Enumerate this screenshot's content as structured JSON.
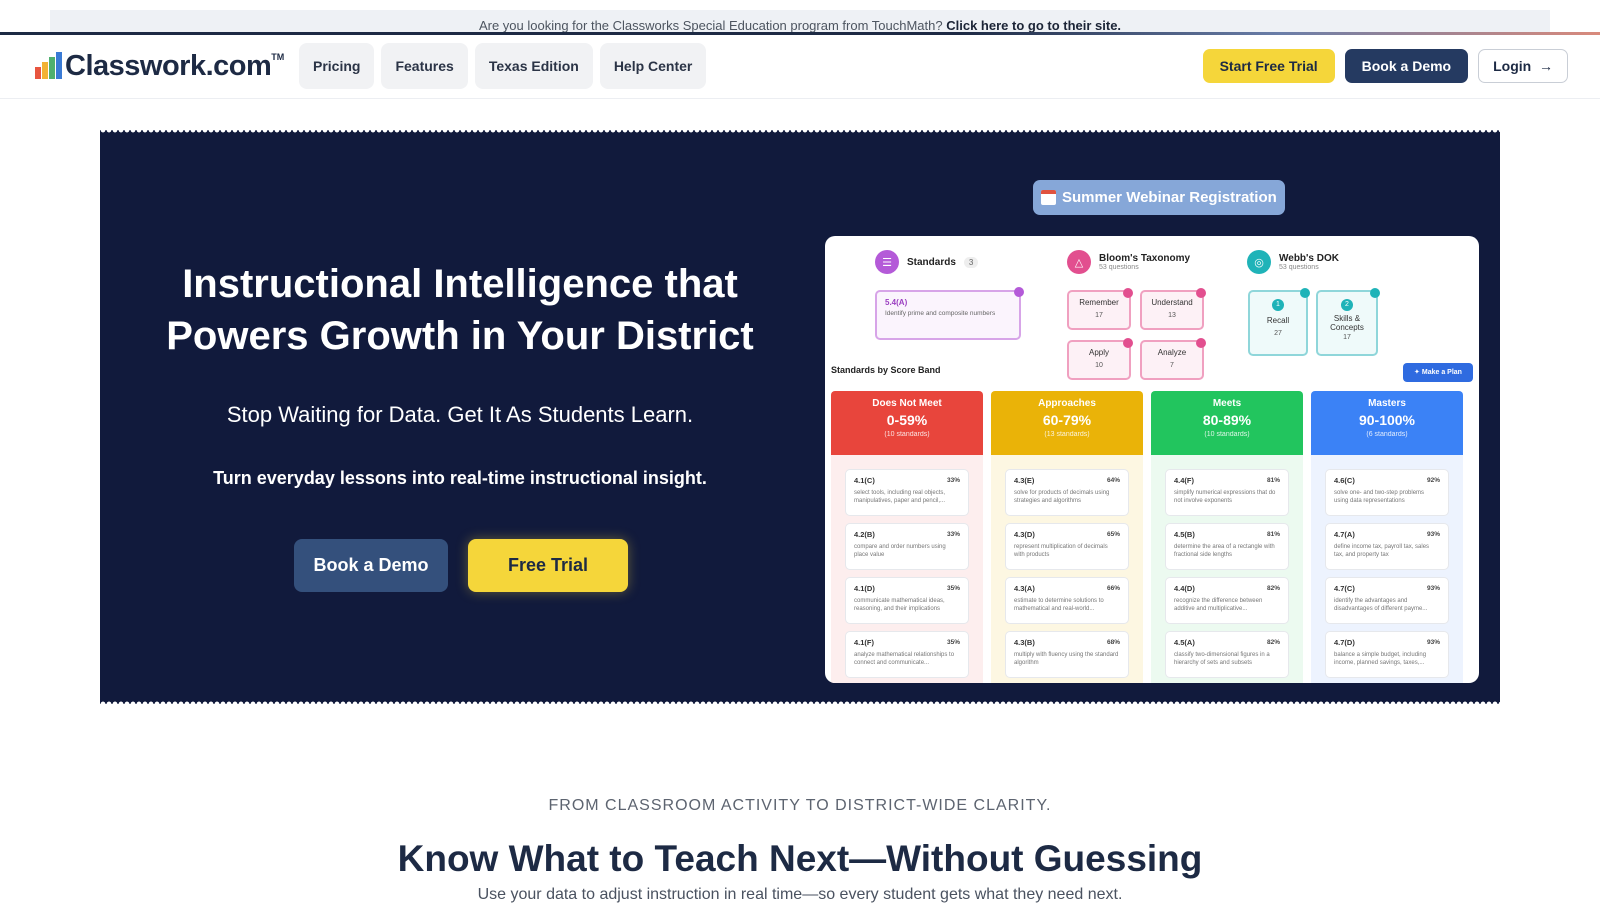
{
  "announcement": {
    "text": "Are you looking for the Classworks Special Education program from TouchMath?",
    "link": "Click here to go to their site."
  },
  "header": {
    "logo": "Classwork.com",
    "logo_tm": "TM",
    "nav": [
      "Pricing",
      "Features",
      "Texas Edition",
      "Help Center"
    ],
    "start_trial": "Start Free Trial",
    "book_demo": "Book a Demo",
    "login": "Login",
    "login_icon": "arrow-right-icon"
  },
  "hero": {
    "title": "Instructional Intelligence that Powers Growth in Your District",
    "subtitle": "Stop Waiting for Data. Get It As Students Learn.",
    "tagline": "Turn everyday lessons into real-time instructional insight.",
    "cta_demo": "Book a Demo",
    "cta_trial": "Free Trial",
    "webinar": "Summer Webinar Registration"
  },
  "dashboard": {
    "standards": {
      "label": "Standards",
      "count": "3",
      "item_id": "5.4(A)",
      "item_desc": "Identify prime and composite numbers"
    },
    "blooms": {
      "label": "Bloom's Taxonomy",
      "sub": "53 questions",
      "items": [
        {
          "label": "Remember",
          "n": "17"
        },
        {
          "label": "Understand",
          "n": "13"
        },
        {
          "label": "Apply",
          "n": "10"
        },
        {
          "label": "Analyze",
          "n": "7"
        }
      ]
    },
    "dok": {
      "label": "Webb's DOK",
      "sub": "53 questions",
      "items": [
        {
          "num": "1",
          "label": "Recall",
          "n": "27"
        },
        {
          "num": "2",
          "label": "Skills & Concepts",
          "n": "17"
        }
      ]
    },
    "band_title": "Standards by Score Band",
    "plan_button": "Make a Plan",
    "bands": [
      {
        "name": "Does Not Meet",
        "range": "0-59%",
        "count": "(10 standards)",
        "color": "#e8453c",
        "cards": [
          {
            "id": "4.1(C)",
            "pct": "33%",
            "desc": "select tools, including real objects, manipulatives, paper and pencil,..."
          },
          {
            "id": "4.2(B)",
            "pct": "33%",
            "desc": "compare and order numbers using place value"
          },
          {
            "id": "4.1(D)",
            "pct": "35%",
            "desc": "communicate mathematical ideas, reasoning, and their implications"
          },
          {
            "id": "4.1(F)",
            "pct": "35%",
            "desc": "analyze mathematical relationships to connect and communicate..."
          }
        ]
      },
      {
        "name": "Approaches",
        "range": "60-79%",
        "count": "(13 standards)",
        "color": "#eab308",
        "cards": [
          {
            "id": "4.3(E)",
            "pct": "64%",
            "desc": "solve for products of decimals using strategies and algorithms"
          },
          {
            "id": "4.3(D)",
            "pct": "65%",
            "desc": "represent multiplication of decimals with products"
          },
          {
            "id": "4.3(A)",
            "pct": "66%",
            "desc": "estimate to determine solutions to mathematical and real-world..."
          },
          {
            "id": "4.3(B)",
            "pct": "68%",
            "desc": "multiply with fluency using the standard algorithm"
          }
        ]
      },
      {
        "name": "Meets",
        "range": "80-89%",
        "count": "(10 standards)",
        "color": "#22c55e",
        "cards": [
          {
            "id": "4.4(F)",
            "pct": "81%",
            "desc": "simplify numerical expressions that do not involve exponents"
          },
          {
            "id": "4.5(B)",
            "pct": "81%",
            "desc": "determine the area of a rectangle with fractional side lengths"
          },
          {
            "id": "4.4(D)",
            "pct": "82%",
            "desc": "recognize the difference between additive and multiplicative..."
          },
          {
            "id": "4.5(A)",
            "pct": "82%",
            "desc": "classify two-dimensional figures in a hierarchy of sets and subsets"
          }
        ]
      },
      {
        "name": "Masters",
        "range": "90-100%",
        "count": "(6 standards)",
        "color": "#3b82f6",
        "cards": [
          {
            "id": "4.6(C)",
            "pct": "92%",
            "desc": "solve one- and two-step problems using data representations"
          },
          {
            "id": "4.7(A)",
            "pct": "93%",
            "desc": "define income tax, payroll tax, sales tax, and property tax"
          },
          {
            "id": "4.7(C)",
            "pct": "93%",
            "desc": "identify the advantages and disadvantages of different payme..."
          },
          {
            "id": "4.7(D)",
            "pct": "93%",
            "desc": "balance a simple budget, including income, planned savings, taxes,..."
          }
        ]
      }
    ]
  },
  "section": {
    "kicker": "FROM CLASSROOM ACTIVITY TO DISTRICT-WIDE CLARITY.",
    "title": "Know What to Teach Next—Without Guessing",
    "desc": "Use your data to adjust instruction in real time—so every student gets what they need next."
  }
}
